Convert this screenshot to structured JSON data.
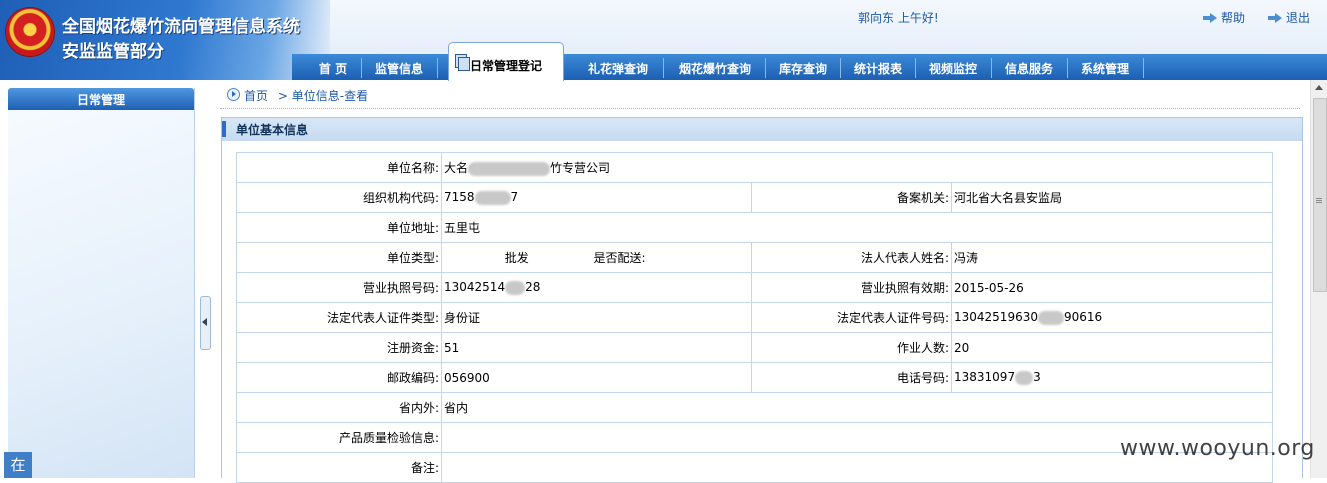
{
  "header": {
    "title": "全国烟花爆竹流向管理信息系统",
    "subtitle": "安监监管部分",
    "greeting": "郭向东  上午好!",
    "help_label": "帮助",
    "logout_label": "退出"
  },
  "nav": {
    "items": [
      "首  页",
      "监管信息",
      "日常管理登记",
      "礼花弹查询",
      "烟花爆竹查询",
      "库存查询",
      "统计报表",
      "视频监控",
      "信息服务",
      "系统管理"
    ],
    "active": "日常管理登记"
  },
  "sidebar": {
    "title": "日常管理",
    "online_tab": "在"
  },
  "breadcrumb": {
    "home": "首页",
    "separator": ">",
    "current": "单位信息-查看"
  },
  "section": {
    "title": "单位基本信息"
  },
  "form": {
    "unit_name_label": "单位名称:",
    "unit_name_prefix": "大名",
    "unit_name_suffix": "竹专营公司",
    "org_code_label": "组织机构代码:",
    "org_code_prefix": "7158",
    "org_code_suffix": "7",
    "record_org_label": "备案机关:",
    "record_org_value": "河北省大名县安监局",
    "address_label": "单位地址:",
    "address_value": "五里屯",
    "unit_type_label": "单位类型:",
    "unit_type_value": "批发",
    "delivery_label": "是否配送:",
    "legal_rep_label": "法人代表人姓名:",
    "legal_rep_value": "冯涛",
    "license_no_label": "营业执照号码:",
    "license_no_prefix": "13042514",
    "license_no_suffix": "28",
    "license_valid_label": "营业执照有效期:",
    "license_valid_value": "2015-05-26",
    "id_type_label": "法定代表人证件类型:",
    "id_type_value": "身份证",
    "id_no_label": "法定代表人证件号码:",
    "id_no_prefix": "13042519630",
    "id_no_suffix": "90616",
    "capital_label": "注册资金:",
    "capital_value": "51",
    "staff_label": "作业人数:",
    "staff_value": "20",
    "postcode_label": "邮政编码:",
    "postcode_value": "056900",
    "phone_label": "电话号码:",
    "phone_prefix": "13831097",
    "phone_suffix": "3",
    "province_label": "省内外:",
    "province_value": "省内",
    "quality_label": "产品质量检验信息:",
    "quality_value": "",
    "remark_label": "备注:",
    "remark_value": ""
  },
  "watermark": "www.wooyun.org",
  "colors": {
    "nav_blue": "#1d5fb2",
    "header_blue": "#2f78d0",
    "link_blue": "#1e58a8",
    "table_border": "#c4d6ea"
  }
}
